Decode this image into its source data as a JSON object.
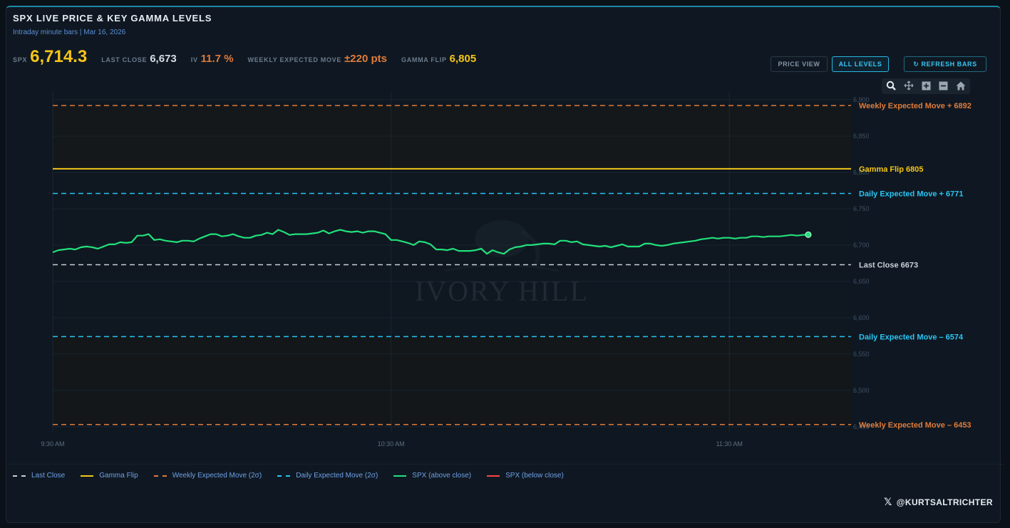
{
  "title": "SPX LIVE PRICE & KEY GAMMA LEVELS",
  "subtitle": "Intraday minute bars | Mar 16, 2026",
  "stats": {
    "spx_label": "SPX",
    "spx_value": "6,714.3",
    "last_close_label": "LAST CLOSE",
    "last_close_value": "6,673",
    "iv_label": "IV",
    "iv_value": "11.7 %",
    "wem_label": "WEEKLY EXPECTED MOVE",
    "wem_value": "±220 pts",
    "gamma_flip_label": "GAMMA FLIP",
    "gamma_flip_value": "6,805"
  },
  "buttons": {
    "price_view": "PRICE VIEW",
    "all_levels": "ALL LEVELS",
    "refresh": "↻ REFRESH BARS",
    "active": "all_levels"
  },
  "modebar": {
    "icons": [
      "zoom-icon",
      "pan-icon",
      "zoom-in-icon",
      "zoom-out-icon",
      "reset-home-icon"
    ]
  },
  "colors": {
    "price_above": "#22e07a",
    "price_below": "#ff4444",
    "gamma_flip": "#f5c518",
    "weekly": "#e07b39",
    "daily": "#29c5f2",
    "last_close": "#c9ced6",
    "background": "#0f1822"
  },
  "watermark": "IVORY HILL",
  "handle": "@KURTSALTRICHTER",
  "chart_data": {
    "type": "line",
    "x_ticks": [
      "9:30 AM",
      "10:30 AM",
      "11:30 AM"
    ],
    "y_ticks": [
      6450,
      6500,
      6550,
      6600,
      6650,
      6700,
      6750,
      6800,
      6850,
      6900
    ],
    "y_tick_labels": [
      "6,450",
      "6,500",
      "6,550",
      "6,600",
      "6,650",
      "6,700",
      "6,750",
      "6,800",
      "6,850",
      "6,900"
    ],
    "ylim": [
      6443,
      6900
    ],
    "x_range_minutes": [
      0,
      134
    ],
    "x_tick_minutes": [
      0,
      60,
      120
    ],
    "levels": [
      {
        "name": "Weekly Expected Move +",
        "value": 6892,
        "style": "dashed",
        "color_key": "weekly"
      },
      {
        "name": "Gamma Flip",
        "value": 6805,
        "style": "solid",
        "color_key": "gamma_flip"
      },
      {
        "name": "Daily Expected Move +",
        "value": 6771,
        "style": "dashed",
        "color_key": "daily"
      },
      {
        "name": "Last Close",
        "value": 6673,
        "style": "dashed",
        "color_key": "last_close"
      },
      {
        "name": "Daily Expected Move –",
        "value": 6574,
        "style": "dashed",
        "color_key": "daily"
      },
      {
        "name": "Weekly Expected Move –",
        "value": 6453,
        "style": "dashed",
        "color_key": "weekly"
      }
    ],
    "series": [
      {
        "name": "SPX (above close)",
        "color_key": "price_above",
        "minutes": [
          0,
          1,
          2,
          3,
          4,
          5,
          6,
          7,
          8,
          9,
          10,
          11,
          12,
          13,
          14,
          15,
          16,
          17,
          18,
          19,
          20,
          21,
          22,
          23,
          24,
          25,
          26,
          27,
          28,
          29,
          30,
          31,
          32,
          33,
          34,
          35,
          36,
          37,
          38,
          39,
          40,
          41,
          42,
          43,
          44,
          45,
          46,
          47,
          48,
          49,
          50,
          51,
          52,
          53,
          54,
          55,
          56,
          57,
          58,
          59,
          60,
          61,
          62,
          63,
          64,
          65,
          66,
          67,
          68,
          69,
          70,
          71,
          72,
          73,
          74,
          75,
          76,
          77,
          78,
          79,
          80,
          81,
          82,
          83,
          84,
          85,
          86,
          87,
          88,
          89,
          90,
          91,
          92,
          93,
          94,
          95,
          96,
          97,
          98,
          99,
          100,
          101,
          102,
          103,
          104,
          105,
          106,
          107,
          108,
          109,
          110,
          111,
          112,
          113,
          114,
          115,
          116,
          117,
          118,
          119,
          120,
          121,
          122,
          123,
          124,
          125,
          126,
          127,
          128,
          129,
          130,
          131,
          132,
          133,
          134
        ],
        "values": [
          6690,
          6693,
          6694,
          6695,
          6694,
          6697,
          6698,
          6697,
          6695,
          6698,
          6701,
          6701,
          6704,
          6703,
          6704,
          6713,
          6713,
          6715,
          6707,
          6708,
          6706,
          6705,
          6704,
          6706,
          6706,
          6705,
          6709,
          6712,
          6715,
          6715,
          6712,
          6713,
          6715,
          6712,
          6710,
          6710,
          6713,
          6714,
          6717,
          6715,
          6721,
          6718,
          6714,
          6715,
          6715,
          6715,
          6716,
          6717,
          6720,
          6716,
          6719,
          6721,
          6719,
          6718,
          6719,
          6717,
          6719,
          6719,
          6717,
          6715,
          6707,
          6707,
          6705,
          6703,
          6700,
          6705,
          6704,
          6701,
          6694,
          6694,
          6693,
          6695,
          6692,
          6692,
          6692,
          6693,
          6695,
          6688,
          6693,
          6690,
          6688,
          6694,
          6697,
          6698,
          6700,
          6700,
          6701,
          6702,
          6702,
          6701,
          6706,
          6706,
          6704,
          6705,
          6701,
          6700,
          6699,
          6698,
          6699,
          6697,
          6699,
          6701,
          6698,
          6698,
          6698,
          6702,
          6702,
          6700,
          6699,
          6700,
          6702,
          6703,
          6704,
          6705,
          6706,
          6708,
          6709,
          6710,
          6709,
          6710,
          6710,
          6709,
          6710,
          6710,
          6712,
          6712,
          6711,
          6712,
          6712,
          6712,
          6713,
          6714,
          6713,
          6714,
          6714.3
        ]
      },
      {
        "name": "SPX (below close)",
        "color_key": "price_below",
        "minutes": [],
        "values": []
      }
    ],
    "legend": [
      {
        "label": "Last Close",
        "color_key": "last_close",
        "style": "dashed"
      },
      {
        "label": "Gamma Flip",
        "color_key": "gamma_flip",
        "style": "solid"
      },
      {
        "label": "Weekly Expected Move (2σ)",
        "color_key": "weekly",
        "style": "dashed"
      },
      {
        "label": "Daily Expected Move (2σ)",
        "color_key": "daily",
        "style": "dashed"
      },
      {
        "label": "SPX (above close)",
        "color_key": "price_above",
        "style": "solid"
      },
      {
        "label": "SPX (below close)",
        "color_key": "price_below",
        "style": "solid"
      }
    ],
    "legend_position": "bottom-left",
    "grid": true
  }
}
